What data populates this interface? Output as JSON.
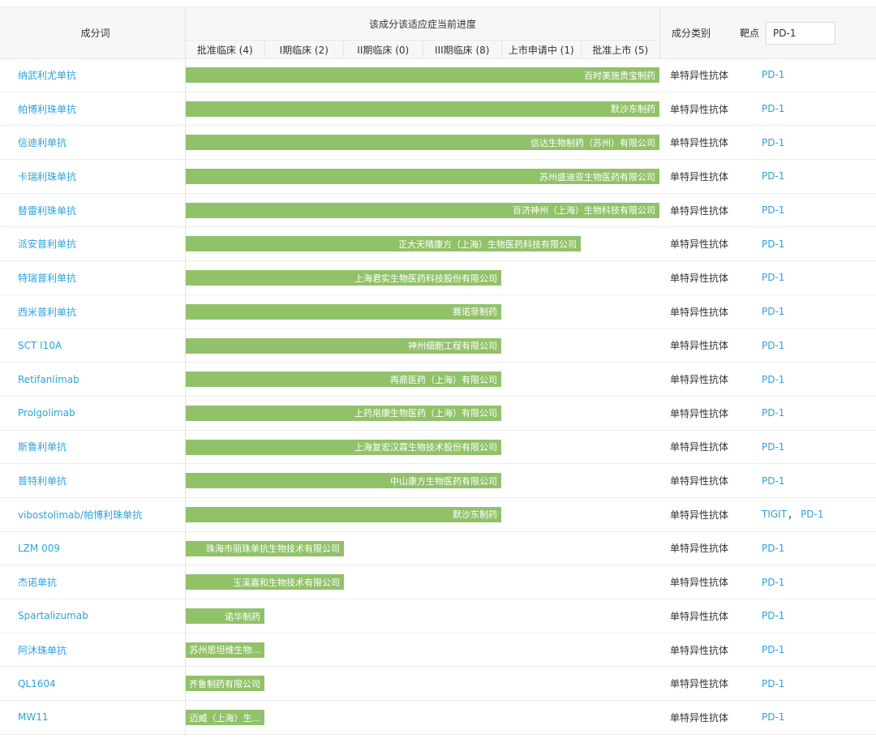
{
  "header": {
    "name_col": "成分词",
    "progress_col": "该成分该适应症当前进度",
    "phases": [
      "批准临床 (4)",
      "I期临床 (2)",
      "II期临床 (0)",
      "III期临床 (8)",
      "上市申请中 (1)",
      "批准上市 (5)"
    ],
    "category_col": "成分类别",
    "target_label": "靶点",
    "target_filter_value": "PD-1"
  },
  "colors": {
    "bar": "#91c26a",
    "link": "#2ea2dc"
  },
  "rows": [
    {
      "name": "纳武利尤单抗",
      "company": "百时美施贵宝制药",
      "stage": 6,
      "category": "单特异性抗体",
      "targets": [
        "PD-1"
      ]
    },
    {
      "name": "帕博利珠单抗",
      "company": "默沙东制药",
      "stage": 6,
      "category": "单特异性抗体",
      "targets": [
        "PD-1"
      ]
    },
    {
      "name": "信迪利单抗",
      "company": "信达生物制药（苏州）有限公司",
      "stage": 6,
      "category": "单特异性抗体",
      "targets": [
        "PD-1"
      ]
    },
    {
      "name": "卡瑞利珠单抗",
      "company": "苏州盛迪亚生物医药有限公司",
      "stage": 6,
      "category": "单特异性抗体",
      "targets": [
        "PD-1"
      ]
    },
    {
      "name": "替雷利珠单抗",
      "company": "百济神州（上海）生物科技有限公司",
      "stage": 6,
      "category": "单特异性抗体",
      "targets": [
        "PD-1"
      ]
    },
    {
      "name": "派安普利单抗",
      "company": "正大天晴康方（上海）生物医药科技有限公司",
      "stage": 5,
      "category": "单特异性抗体",
      "targets": [
        "PD-1"
      ]
    },
    {
      "name": "特瑞普利单抗",
      "company": "上海君实生物医药科技股份有限公司",
      "stage": 4,
      "category": "单特异性抗体",
      "targets": [
        "PD-1"
      ]
    },
    {
      "name": "西米普利单抗",
      "company": "赛诺菲制药",
      "stage": 4,
      "category": "单特异性抗体",
      "targets": [
        "PD-1"
      ]
    },
    {
      "name": "SCT I10A",
      "company": "神州细胞工程有限公司",
      "stage": 4,
      "category": "单特异性抗体",
      "targets": [
        "PD-1"
      ]
    },
    {
      "name": "Retifanlimab",
      "company": "再鼎医药（上海）有限公司",
      "stage": 4,
      "category": "单特异性抗体",
      "targets": [
        "PD-1"
      ]
    },
    {
      "name": "Prolgolimab",
      "company": "上药帛康生物医药（上海）有限公司",
      "stage": 4,
      "category": "单特异性抗体",
      "targets": [
        "PD-1"
      ]
    },
    {
      "name": "斯鲁利单抗",
      "company": "上海复宏汉霖生物技术股份有限公司",
      "stage": 4,
      "category": "单特异性抗体",
      "targets": [
        "PD-1"
      ]
    },
    {
      "name": "普特利单抗",
      "company": "中山康方生物医药有限公司",
      "stage": 4,
      "category": "单特异性抗体",
      "targets": [
        "PD-1"
      ]
    },
    {
      "name": "vibostolimab/帕博利珠单抗",
      "company": "默沙东制药",
      "stage": 4,
      "category": "单特异性抗体",
      "targets": [
        "TIGIT",
        "PD-1"
      ]
    },
    {
      "name": "LZM 009",
      "company": "珠海市丽珠单抗生物技术有限公司",
      "stage": 2,
      "category": "单特异性抗体",
      "targets": [
        "PD-1"
      ]
    },
    {
      "name": "杰诺单抗",
      "company": "玉溪嘉和生物技术有限公司",
      "stage": 2,
      "category": "单特异性抗体",
      "targets": [
        "PD-1"
      ]
    },
    {
      "name": "Spartalizumab",
      "company": "诺华制药",
      "stage": 1,
      "category": "单特异性抗体",
      "targets": [
        "PD-1"
      ]
    },
    {
      "name": "阿沐珠单抗",
      "company": "苏州思坦维生物...",
      "stage": 1,
      "category": "单特异性抗体",
      "targets": [
        "PD-1"
      ]
    },
    {
      "name": "QL1604",
      "company": "齐鲁制药有限公司",
      "stage": 1,
      "category": "单特异性抗体",
      "targets": [
        "PD-1"
      ]
    },
    {
      "name": "MW11",
      "company": "迈威（上海）生...",
      "stage": 1,
      "category": "单特异性抗体",
      "targets": [
        "PD-1"
      ]
    }
  ]
}
